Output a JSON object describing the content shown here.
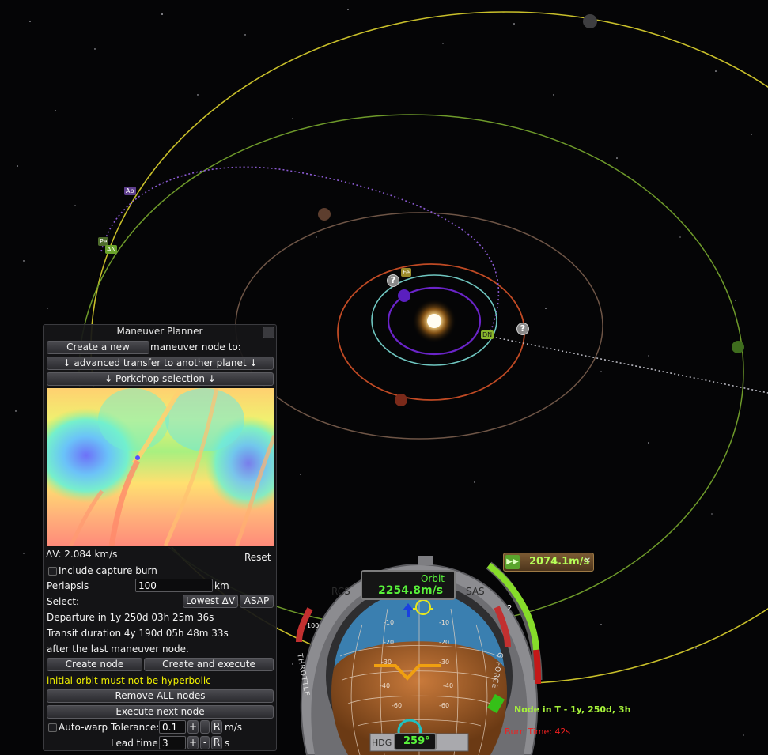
{
  "planner": {
    "title": "Maneuver Planner",
    "create_new_button": "Create a new",
    "create_new_suffix": "maneuver node to:",
    "operation_dropdown": "↓ advanced transfer to another planet ↓",
    "porkchop_dropdown": "↓ Porkchop selection ↓",
    "delta_v": "ΔV: 2.084 km/s",
    "reset_button": "Reset",
    "include_capture_burn": "Include capture burn",
    "periapsis_label": "Periapsis",
    "periapsis_value": "100",
    "periapsis_unit": "km",
    "select_label": "Select:",
    "lowest_dv_button": "Lowest ΔV",
    "asap_button": "ASAP",
    "departure": "Departure in 1y 250d 03h 25m 36s",
    "transit": "Transit duration 4y 190d 05h 48m 33s",
    "after_node": "after the last maneuver node.",
    "create_node_button": "Create node",
    "create_execute_button": "Create and execute",
    "warning": "initial orbit must not be hyperbolic",
    "warning_color": "#f0f000",
    "remove_all_button": "Remove ALL nodes",
    "execute_next_button": "Execute next node",
    "auto_warp_label": "Auto-warp",
    "tolerance_label": "Tolerance:",
    "tolerance_value": "0.1",
    "tolerance_unit": "m/s",
    "lead_time_label": "Lead time:",
    "lead_time_value": "3",
    "lead_time_unit": "s",
    "plus_label": "+",
    "minus_label": "-",
    "reset_small_label": "R"
  },
  "map": {
    "markers": {
      "ap": "Ap",
      "pe": "Pe",
      "an": "AN",
      "dn": "DN",
      "fe": "Fe",
      "unknown": "?"
    }
  },
  "navball": {
    "maneuver_dv": "2074.1m/s",
    "mode": "Orbit",
    "speed": "2254.8m/s",
    "rcs_label": "RCS",
    "sas_label": "SAS",
    "heading_label": "HDG",
    "heading_value": "259°",
    "throttle_label": "THROTTLE",
    "gforce_label": "G FORCE",
    "gauge_marks": [
      "100",
      "2"
    ],
    "node_info": "Node in T - 1y, 250d, 3h",
    "burn_time": "Burn Time: 42s"
  }
}
